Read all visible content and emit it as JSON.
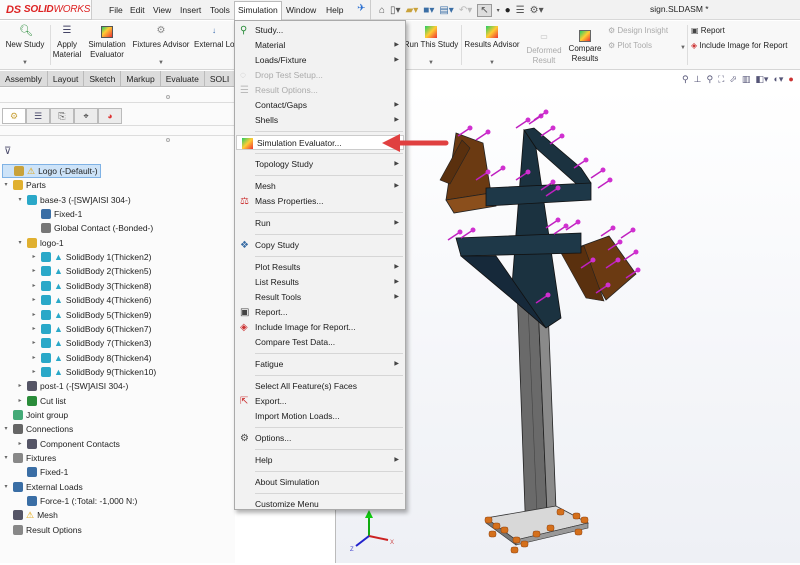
{
  "app": {
    "brand_prefix": "DS",
    "brand_name_bold": "SOLID",
    "brand_name_rest": "WORKS",
    "document_title": "sign.SLDASM *"
  },
  "menubar": {
    "items": [
      "File",
      "Edit",
      "View",
      "Insert",
      "Tools",
      "Simulation",
      "Window",
      "Help"
    ],
    "open_menu": "Simulation"
  },
  "quick_access": {
    "icons": [
      "home-icon",
      "new-document-icon",
      "open-folder-icon",
      "save-icon",
      "print-icon",
      "undo-icon",
      "select-pointer-icon",
      "rebuild-traffic-light-icon",
      "file-properties-icon",
      "options-gear-icon"
    ]
  },
  "command_manager": {
    "buttons": [
      {
        "label": "New Study",
        "icon": "new-study-icon",
        "enabled": true,
        "dropdown": true
      },
      {
        "label": "Apply Material",
        "icon": "apply-material-icon",
        "enabled": true,
        "dropdown": false
      },
      {
        "label": "Simulation Evaluator",
        "icon": "simulation-evaluator-icon",
        "enabled": true,
        "dropdown": false
      },
      {
        "label": "Fixtures Advisor",
        "icon": "fixtures-advisor-icon",
        "enabled": true,
        "dropdown": true
      },
      {
        "label": "External Lo",
        "icon": "external-loads-icon",
        "enabled": true,
        "dropdown": false
      },
      {
        "label": "Run This Study",
        "icon": "run-study-icon",
        "enabled": true,
        "dropdown": true
      },
      {
        "label": "Results Advisor",
        "icon": "results-advisor-icon",
        "enabled": true,
        "dropdown": true
      },
      {
        "label": "Deformed Result",
        "icon": "deformed-result-icon",
        "enabled": false,
        "dropdown": false
      },
      {
        "label": "Compare Results",
        "icon": "compare-results-icon",
        "enabled": true,
        "dropdown": false
      }
    ],
    "small_buttons": [
      {
        "label": "Design Insight",
        "enabled": false
      },
      {
        "label": "Plot Tools",
        "enabled": false
      },
      {
        "label": "Report",
        "enabled": true
      },
      {
        "label": "Include Image for Report",
        "enabled": true
      }
    ]
  },
  "tabs": [
    "Assembly",
    "Layout",
    "Sketch",
    "Markup",
    "Evaluate",
    "SOLI"
  ],
  "feature_manager_tabs": [
    "feature-manager-icon",
    "property-manager-icon",
    "configuration-manager-icon",
    "dimxpert-icon",
    "display-manager-icon"
  ],
  "tree": [
    {
      "label": "Logo (-Default-)",
      "level": 0,
      "twisty": "",
      "icon": "study-icon",
      "warning": true,
      "selected": true
    },
    {
      "label": "Parts",
      "level": 0,
      "twisty": "open",
      "icon": "parts-icon"
    },
    {
      "label": "base-3 (-[SW]AISI 304-)",
      "level": 1,
      "twisty": "open",
      "icon": "solid-body-icon"
    },
    {
      "label": "Fixed-1",
      "level": 2,
      "twisty": "",
      "icon": "fixture-icon"
    },
    {
      "label": "Global Contact (-Bonded-)",
      "level": 2,
      "twisty": "",
      "icon": "contact-icon"
    },
    {
      "label": "logo-1",
      "level": 1,
      "twisty": "open",
      "icon": "part-icon"
    },
    {
      "label": "SolidBody 1(Thicken2)",
      "level": 2,
      "twisty": "closed",
      "icon": "solid-body-icon"
    },
    {
      "label": "SolidBody 2(Thicken5)",
      "level": 2,
      "twisty": "closed",
      "icon": "solid-body-icon"
    },
    {
      "label": "SolidBody 3(Thicken8)",
      "level": 2,
      "twisty": "closed",
      "icon": "solid-body-icon"
    },
    {
      "label": "SolidBody 4(Thicken6)",
      "level": 2,
      "twisty": "closed",
      "icon": "solid-body-icon"
    },
    {
      "label": "SolidBody 5(Thicken9)",
      "level": 2,
      "twisty": "closed",
      "icon": "solid-body-icon"
    },
    {
      "label": "SolidBody 6(Thicken7)",
      "level": 2,
      "twisty": "closed",
      "icon": "solid-body-icon"
    },
    {
      "label": "SolidBody 7(Thicken3)",
      "level": 2,
      "twisty": "closed",
      "icon": "solid-body-icon"
    },
    {
      "label": "SolidBody 8(Thicken4)",
      "level": 2,
      "twisty": "closed",
      "icon": "solid-body-icon"
    },
    {
      "label": "SolidBody 9(Thicken10)",
      "level": 2,
      "twisty": "closed",
      "icon": "solid-body-icon"
    },
    {
      "label": "post-1 (-[SW]AISI 304-)",
      "level": 1,
      "twisty": "closed",
      "icon": "weldment-icon"
    },
    {
      "label": "Cut list",
      "level": 1,
      "twisty": "closed",
      "icon": "cut-list-icon"
    },
    {
      "label": "Joint group",
      "level": 0,
      "twisty": "",
      "icon": "joint-group-icon"
    },
    {
      "label": "Connections",
      "level": 0,
      "twisty": "open",
      "icon": "connections-icon"
    },
    {
      "label": "Component Contacts",
      "level": 1,
      "twisty": "closed",
      "icon": "component-contacts-icon"
    },
    {
      "label": "Fixtures",
      "level": 0,
      "twisty": "open",
      "icon": "fixtures-icon"
    },
    {
      "label": "Fixed-1",
      "level": 1,
      "twisty": "",
      "icon": "fixture-icon"
    },
    {
      "label": "External Loads",
      "level": 0,
      "twisty": "open",
      "icon": "external-loads-icon"
    },
    {
      "label": "Force-1 (:Total: -1,000 N:)",
      "level": 1,
      "twisty": "",
      "icon": "force-icon"
    },
    {
      "label": "Mesh",
      "level": 0,
      "twisty": "",
      "icon": "mesh-icon",
      "warning": true
    },
    {
      "label": "Result Options",
      "level": 0,
      "twisty": "",
      "icon": "result-options-icon"
    }
  ],
  "simulation_menu": [
    {
      "label": "Study...",
      "icon": "study-icon",
      "submenu": false,
      "enabled": true
    },
    {
      "label": "Material",
      "submenu": true,
      "enabled": true
    },
    {
      "label": "Loads/Fixture",
      "submenu": true,
      "enabled": true
    },
    {
      "label": "Drop Test Setup...",
      "icon": "drop-test-icon",
      "submenu": false,
      "enabled": false
    },
    {
      "label": "Result Options...",
      "icon": "result-options-icon",
      "submenu": false,
      "enabled": false
    },
    {
      "label": "Contact/Gaps",
      "submenu": true,
      "enabled": true
    },
    {
      "label": "Shells",
      "submenu": true,
      "enabled": true
    },
    {
      "separator": true
    },
    {
      "label": "Simulation Evaluator...",
      "icon": "simulation-evaluator-icon",
      "submenu": false,
      "enabled": true,
      "highlighted": true
    },
    {
      "separator": true
    },
    {
      "label": "Topology Study",
      "submenu": true,
      "enabled": true
    },
    {
      "separator": true
    },
    {
      "label": "Mesh",
      "submenu": true,
      "enabled": true
    },
    {
      "label": "Mass Properties...",
      "icon": "mass-properties-icon",
      "submenu": false,
      "enabled": true
    },
    {
      "separator": true
    },
    {
      "label": "Run",
      "submenu": true,
      "enabled": true
    },
    {
      "separator": true
    },
    {
      "label": "Copy Study",
      "icon": "copy-study-icon",
      "submenu": false,
      "enabled": true
    },
    {
      "separator": true
    },
    {
      "label": "Plot Results",
      "submenu": true,
      "enabled": true
    },
    {
      "label": "List Results",
      "submenu": true,
      "enabled": true
    },
    {
      "label": "Result Tools",
      "submenu": true,
      "enabled": true
    },
    {
      "label": "Report...",
      "icon": "report-icon",
      "submenu": false,
      "enabled": true
    },
    {
      "label": "Include Image for Report...",
      "icon": "include-image-icon",
      "submenu": false,
      "enabled": true
    },
    {
      "label": "Compare Test Data...",
      "submenu": false,
      "enabled": true
    },
    {
      "separator": true
    },
    {
      "label": "Fatigue",
      "submenu": true,
      "enabled": true
    },
    {
      "separator": true
    },
    {
      "label": "Select All Feature(s) Faces",
      "submenu": false,
      "enabled": true
    },
    {
      "label": "Export...",
      "icon": "export-icon",
      "submenu": false,
      "enabled": true
    },
    {
      "label": "Import Motion Loads...",
      "submenu": false,
      "enabled": true
    },
    {
      "separator": true
    },
    {
      "label": "Options...",
      "icon": "options-icon",
      "submenu": false,
      "enabled": true
    },
    {
      "separator": true
    },
    {
      "label": "Help",
      "submenu": true,
      "enabled": true
    },
    {
      "separator": true
    },
    {
      "label": "About Simulation",
      "submenu": false,
      "enabled": true
    },
    {
      "separator": true
    },
    {
      "label": "Customize Menu",
      "submenu": false,
      "enabled": true
    }
  ],
  "annotation": {
    "arrow_color": "#e04040",
    "points_to": "Simulation Evaluator..."
  },
  "triad": {
    "x_label": "X",
    "y_label": "Y",
    "z_label": "Z"
  },
  "colors": {
    "brand_red": "#d22222",
    "logo_dark": "#1b3240",
    "logo_brown": "#6b3a12",
    "force_arrows": "#c020c0",
    "fixture_orange": "#d4701c"
  }
}
